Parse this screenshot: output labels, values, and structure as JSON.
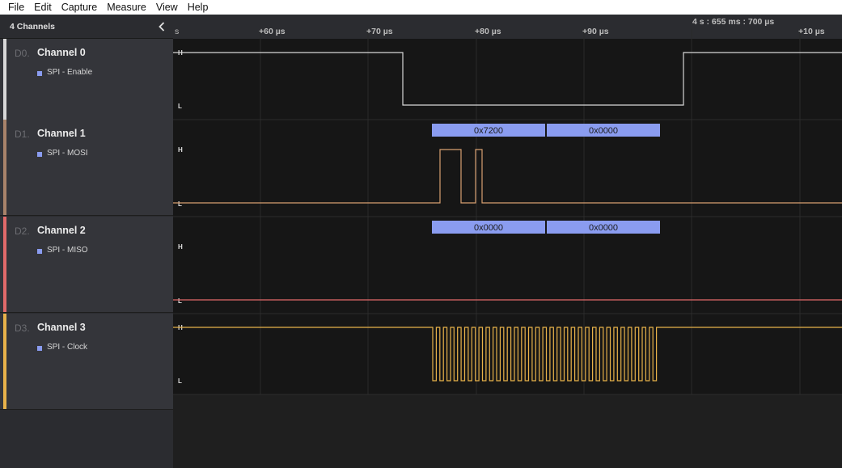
{
  "menu": [
    "File",
    "Edit",
    "Capture",
    "Measure",
    "View",
    "Help"
  ],
  "sidebar": {
    "header": "4 Channels",
    "channels": [
      {
        "id": "D0.",
        "name": "Channel 0",
        "analyzer": "SPI - Enable",
        "color": "#d8d8d8"
      },
      {
        "id": "D1.",
        "name": "Channel 1",
        "analyzer": "SPI - MOSI",
        "color": "#a8836a"
      },
      {
        "id": "D2.",
        "name": "Channel 2",
        "analyzer": "SPI - MISO",
        "color": "#e26a6a"
      },
      {
        "id": "D3.",
        "name": "Channel 3",
        "analyzer": "SPI - Clock",
        "color": "#e8b24a"
      }
    ]
  },
  "timeline": {
    "partial_label": "s",
    "ticks": [
      "+60 µs",
      "+70 µs",
      "+80 µs",
      "+90 µs",
      "+10 µs"
    ],
    "reference_label": "4 s : 655 ms : 700 µs",
    "high_label": "H",
    "low_label": "L"
  },
  "decoded": {
    "mosi": [
      "0x7200",
      "0x0000"
    ],
    "miso": [
      "0x0000",
      "0x0000"
    ]
  },
  "colors": {
    "enable_trace": "#d8d8d8",
    "mosi_trace": "#d8a070",
    "miso_trace": "#e26a6a",
    "clock_trace": "#e8b24a",
    "decode_box": "#8a9cf0",
    "wave_bg": "#161616",
    "grid": "#2a2a2a"
  },
  "icons": {
    "collapse": "chevron-left-icon",
    "analyzer": "square-dot-icon"
  }
}
